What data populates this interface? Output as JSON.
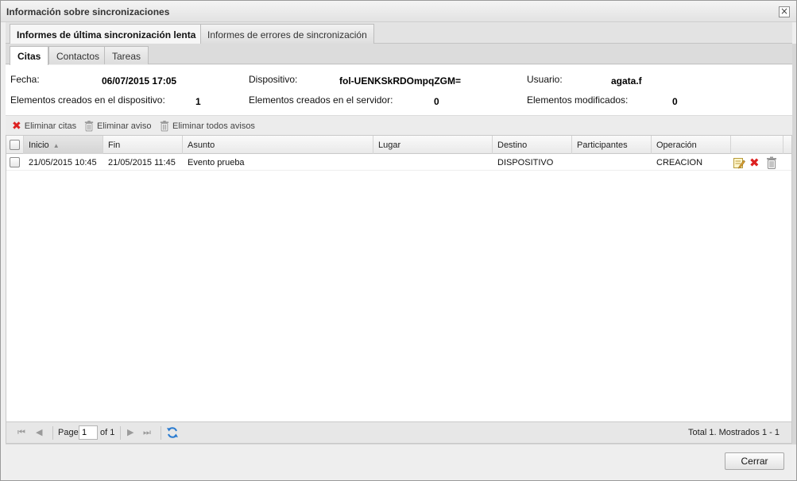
{
  "window": {
    "title": "Información sobre sincronizaciones"
  },
  "tabs_top": [
    {
      "label": "Informes de última sincronización lenta",
      "active": true
    },
    {
      "label": "Informes de errores de sincronización",
      "active": false
    }
  ],
  "tabs_sub": [
    {
      "label": "Citas",
      "active": true
    },
    {
      "label": "Contactos",
      "active": false
    },
    {
      "label": "Tareas",
      "active": false
    }
  ],
  "info": {
    "fecha_label": "Fecha:",
    "fecha_value": "06/07/2015 17:05",
    "dispositivo_label": "Dispositivo:",
    "dispositivo_value": "fol-UENKSkRDOmpqZGM=",
    "usuario_label": "Usuario:",
    "usuario_value": "agata.f",
    "creados_disp_label": "Elementos creados en el dispositivo:",
    "creados_disp_value": "1",
    "creados_serv_label": "Elementos creados en el servidor:",
    "creados_serv_value": "0",
    "modificados_label": "Elementos modificados:",
    "modificados_value": "0"
  },
  "toolbar": {
    "eliminar_citas": "Eliminar citas",
    "eliminar_aviso": "Eliminar aviso",
    "eliminar_todos": "Eliminar todos avisos"
  },
  "grid": {
    "columns": [
      "Inicio",
      "Fin",
      "Asunto",
      "Lugar",
      "Destino",
      "Participantes",
      "Operación"
    ],
    "rows": [
      {
        "inicio": "21/05/2015 10:45",
        "fin": "21/05/2015 11:45",
        "asunto": "Evento prueba",
        "lugar": "",
        "destino": "DISPOSITIVO",
        "participantes": "",
        "operacion": "CREACION"
      }
    ]
  },
  "pager": {
    "page_label": "Page",
    "page_value": "1",
    "of_label": "of 1",
    "summary": "Total   1. Mostrados 1 - 1"
  },
  "footer": {
    "close_label": "Cerrar"
  },
  "colors": {
    "delete_red": "#dd2222",
    "refresh_blue": "#2a7bd0"
  }
}
